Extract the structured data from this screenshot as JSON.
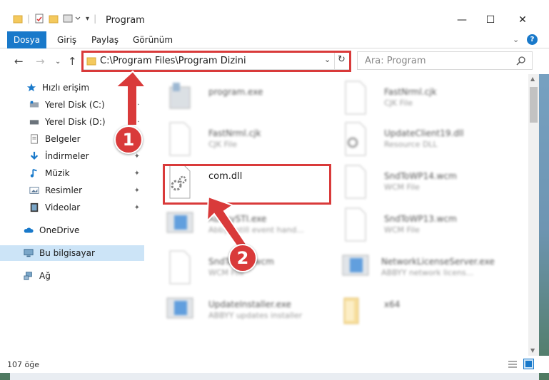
{
  "window": {
    "title": "Program",
    "minimize": "—",
    "maximize": "☐",
    "close": "✕"
  },
  "ribbon": {
    "tabs": [
      "Dosya",
      "Giriş",
      "Paylaş",
      "Görünüm"
    ]
  },
  "address": {
    "path": "C:\\Program Files\\Program Dizini",
    "refresh": "↻"
  },
  "search": {
    "placeholder": "Ara: Program"
  },
  "sidebar": {
    "items": [
      {
        "label": "Hızlı erişim"
      },
      {
        "label": "Yerel Disk (C:)"
      },
      {
        "label": "Yerel Disk (D:)"
      },
      {
        "label": "Belgeler"
      },
      {
        "label": "İndirmeler"
      },
      {
        "label": "Müzik"
      },
      {
        "label": "Resimler"
      },
      {
        "label": "Videolar"
      },
      {
        "label": "OneDrive"
      },
      {
        "label": "Bu bilgisayar"
      },
      {
        "label": "Ağ"
      }
    ]
  },
  "files": [
    {
      "name": "program.exe",
      "type": ""
    },
    {
      "name": "FastNrml.cjk",
      "type": "CJK File"
    },
    {
      "name": "FastNrml.cjk",
      "type": "CJK File"
    },
    {
      "name": "UpdateClient19.dll",
      "type": "Resource DLL"
    },
    {
      "name": "com.dll",
      "type": ""
    },
    {
      "name": "SndToWP14.wcm",
      "type": "WCM File"
    },
    {
      "name": "AbbyySTI.exe",
      "type": "Abbyy still event hand..."
    },
    {
      "name": "SndToWP13.wcm",
      "type": "WCM File"
    },
    {
      "name": "SndToMail.wcm",
      "type": "WCM File"
    },
    {
      "name": "NetworkLicenseServer.exe",
      "type": "ABBYY network licens..."
    },
    {
      "name": "UpdateInstaller.exe",
      "type": "ABBYY updates installer"
    },
    {
      "name": "x64",
      "type": ""
    }
  ],
  "status": {
    "count": "107 öğe"
  },
  "annotations": {
    "step1": "1",
    "step2": "2",
    "color": "#d93a3a"
  }
}
